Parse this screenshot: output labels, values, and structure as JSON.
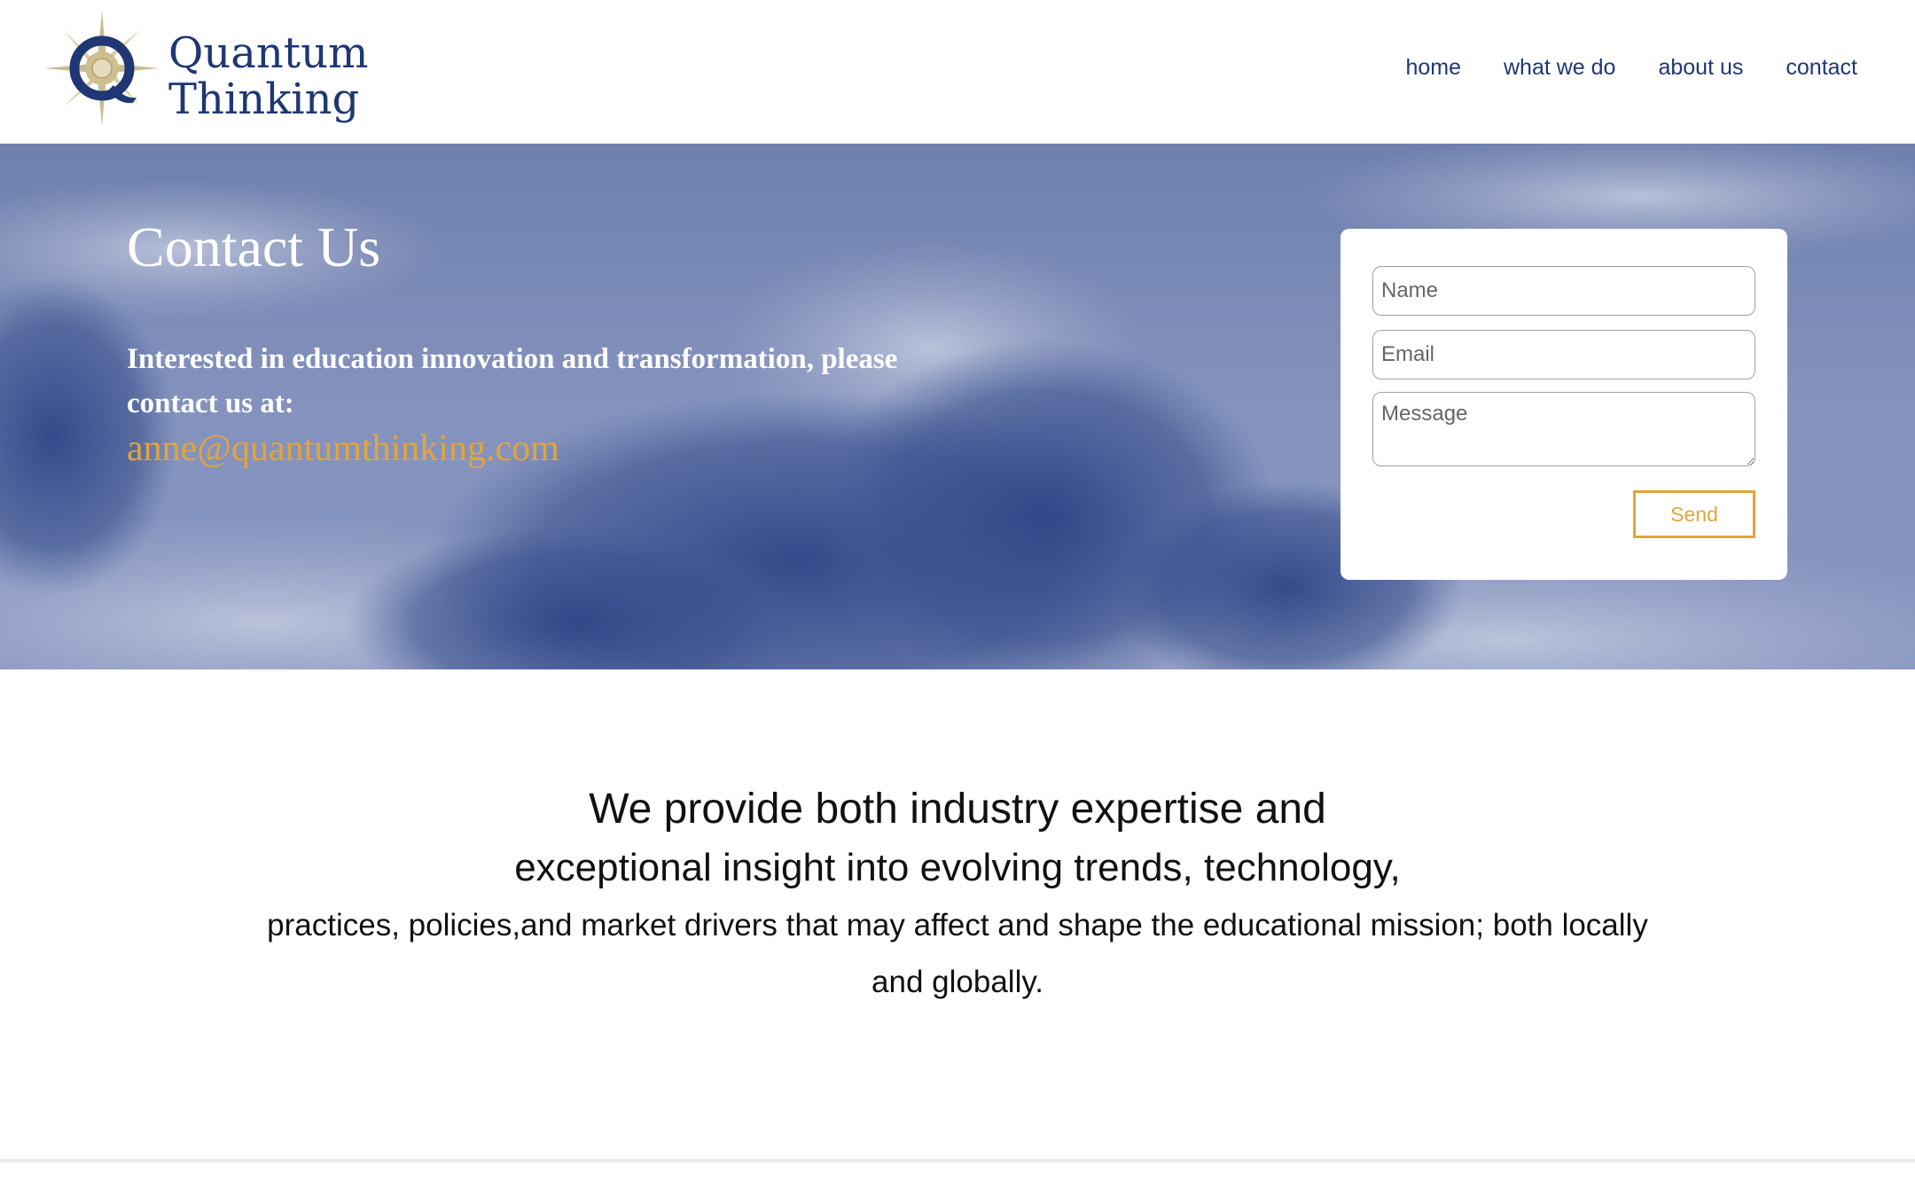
{
  "brand": {
    "name_line1": "Quantum",
    "name_line2": "Thinking",
    "logo_icon": "compass-q-icon",
    "primary_color": "#1f3773",
    "accent_color": "#e3a43a"
  },
  "nav": {
    "items": [
      {
        "label": "home"
      },
      {
        "label": "what we do"
      },
      {
        "label": "about us"
      },
      {
        "label": "contact"
      }
    ]
  },
  "hero": {
    "title": "Contact Us",
    "text": "Interested in education innovation and transformation, please contact us at:",
    "email": "anne@quantumthinking.com"
  },
  "form": {
    "name_placeholder": "Name",
    "email_placeholder": "Email",
    "message_placeholder": "Message",
    "send_label": "Send"
  },
  "mission": {
    "line1": "We provide both industry expertise and",
    "line2": "exceptional insight into evolving trends, technology,",
    "line3": "practices, policies,and market drivers that may affect and shape the educational mission; both locally and globally."
  }
}
